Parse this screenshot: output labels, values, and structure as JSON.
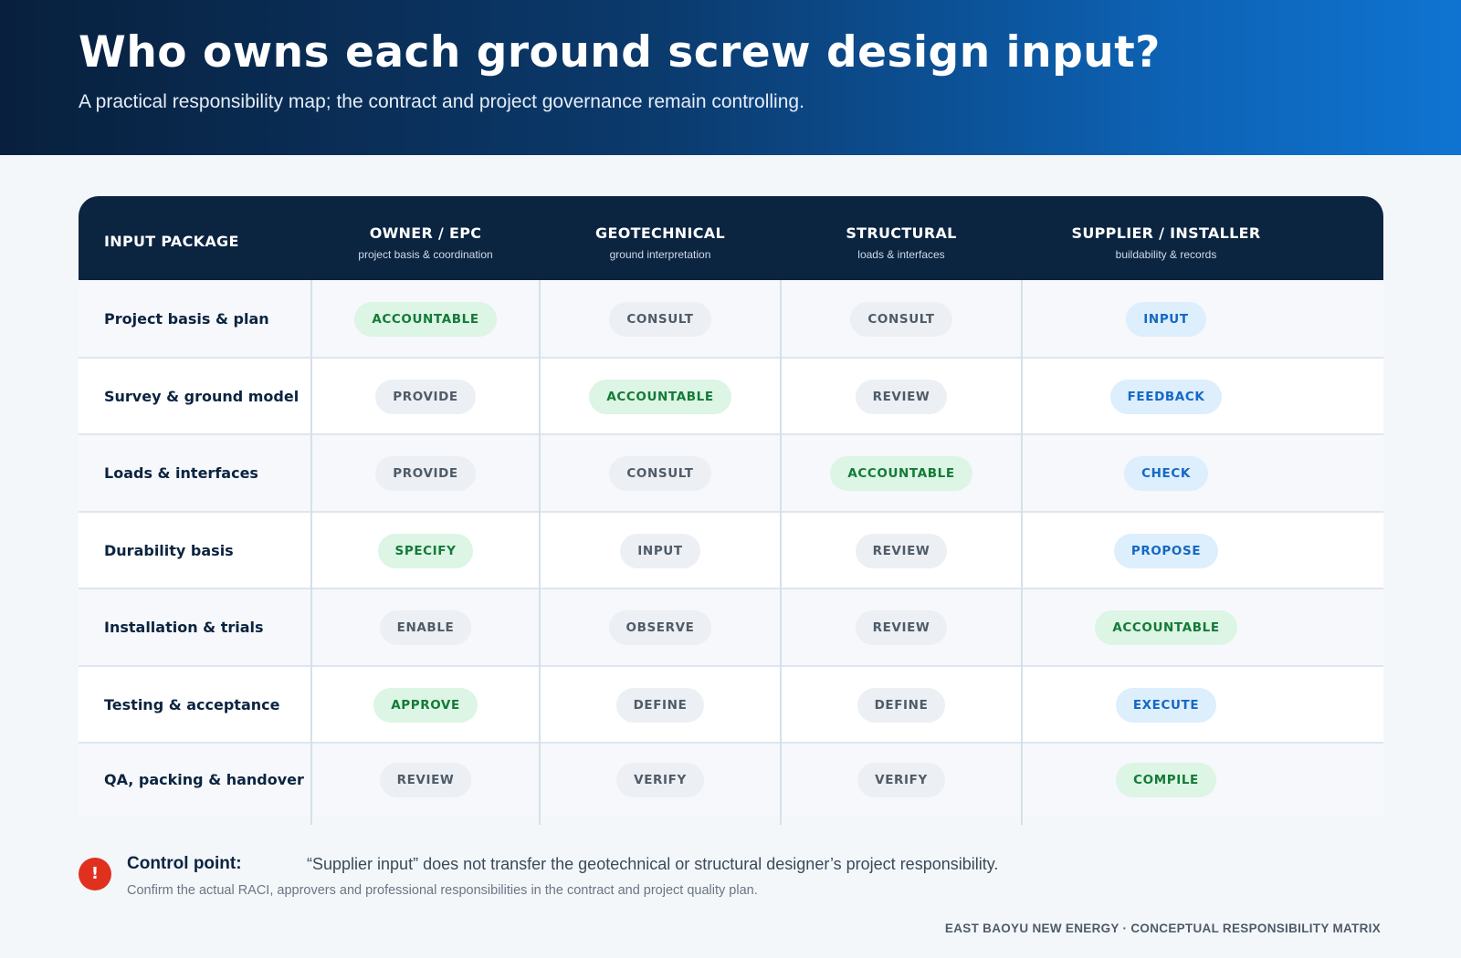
{
  "title": "Who owns each ground screw design input?",
  "subtitle": "A practical responsibility map; the contract and project governance remain controlling.",
  "matrix": {
    "first_header": "INPUT PACKAGE",
    "columns": [
      {
        "title": "OWNER / EPC",
        "sub": "project basis & coordination"
      },
      {
        "title": "GEOTECHNICAL",
        "sub": "ground interpretation"
      },
      {
        "title": "STRUCTURAL",
        "sub": "loads & interfaces"
      },
      {
        "title": "SUPPLIER / INSTALLER",
        "sub": "buildability & records"
      }
    ],
    "rows": [
      {
        "label": "Project basis & plan",
        "cells": [
          "ACCOUNTABLE",
          "CONSULT",
          "CONSULT",
          "INPUT"
        ]
      },
      {
        "label": "Survey & ground model",
        "cells": [
          "PROVIDE",
          "ACCOUNTABLE",
          "REVIEW",
          "FEEDBACK"
        ]
      },
      {
        "label": "Loads & interfaces",
        "cells": [
          "PROVIDE",
          "CONSULT",
          "ACCOUNTABLE",
          "CHECK"
        ]
      },
      {
        "label": "Durability basis",
        "cells": [
          "SPECIFY",
          "INPUT",
          "REVIEW",
          "PROPOSE"
        ]
      },
      {
        "label": "Installation & trials",
        "cells": [
          "ENABLE",
          "OBSERVE",
          "REVIEW",
          "ACCOUNTABLE"
        ]
      },
      {
        "label": "Testing & acceptance",
        "cells": [
          "APPROVE",
          "DEFINE",
          "DEFINE",
          "EXECUTE"
        ]
      },
      {
        "label": "QA, packing & handover",
        "cells": [
          "REVIEW",
          "VERIFY",
          "VERIFY",
          "COMPILE"
        ]
      }
    ],
    "pill_colors": {
      "green": {
        "bg": "#dcf5e4",
        "fg": "#147a38"
      },
      "neutral": {
        "bg": "#eceff3",
        "fg": "#4f5b68"
      },
      "blue": {
        "bg": "#ddeefc",
        "fg": "#1469c4"
      }
    }
  },
  "note": {
    "icon": "exclamation-icon",
    "icon_glyph": "!",
    "title": "Control point:",
    "quote": "“Supplier input” does not transfer the geotechnical or structural designer’s project responsibility.",
    "sub": "Confirm the actual RACI, approvers and professional responsibilities in the contract and project quality plan."
  },
  "footer": "EAST BAOYU NEW ENERGY · CONCEPTUAL RESPONSIBILITY MATRIX"
}
